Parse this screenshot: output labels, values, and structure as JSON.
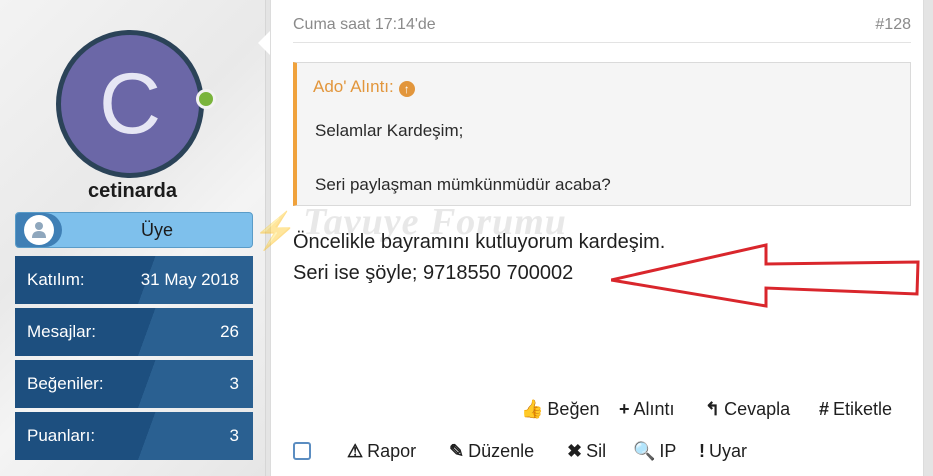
{
  "user": {
    "avatar_letter": "C",
    "username": "cetinarda",
    "role": "Üye",
    "stats": [
      {
        "label": "Katılım:",
        "value": "31 May 2018"
      },
      {
        "label": "Mesajlar:",
        "value": "26"
      },
      {
        "label": "Beğeniler:",
        "value": "3"
      },
      {
        "label": "Puanları:",
        "value": "3"
      }
    ]
  },
  "post": {
    "date": "Cuma saat 17:14'de",
    "number": "#128",
    "quote": {
      "author": "Ado' Alıntı:",
      "lines": [
        "Selamlar Kardeşim;",
        "Seri paylaşman mümkünmüdür acaba?"
      ]
    },
    "body": [
      "Öncelikle bayramını kutluyorum kardeşim.",
      "Seri ise şöyle; 9718550 700002"
    ],
    "watermark": "Tavuye Forumu",
    "actions_primary": [
      {
        "icon": "thumbs-up-icon",
        "glyph": "👍",
        "label": "Beğen"
      },
      {
        "icon": "plus-icon",
        "glyph": "+",
        "label": "Alıntı"
      },
      {
        "icon": "reply-icon",
        "glyph": "↰",
        "label": "Cevapla"
      },
      {
        "icon": "hashtag-icon",
        "glyph": "#",
        "label": "Etiketle"
      }
    ],
    "actions_secondary": [
      {
        "icon": "warning-icon",
        "glyph": "⚠",
        "label": "Rapor"
      },
      {
        "icon": "pencil-icon",
        "glyph": "✎",
        "label": "Düzenle"
      },
      {
        "icon": "close-icon",
        "glyph": "✖",
        "label": "Sil"
      },
      {
        "icon": "search-icon",
        "glyph": "🔍",
        "label": "IP"
      },
      {
        "icon": "exclamation-icon",
        "glyph": "!",
        "label": "Uyar"
      }
    ]
  },
  "colors": {
    "avatar_bg": "#6b67a7",
    "stats_bg": "#1d4f7f",
    "role_bg": "#7ec0ec",
    "quote_accent": "#f0a23c",
    "annotation_arrow": "#d9262c"
  }
}
